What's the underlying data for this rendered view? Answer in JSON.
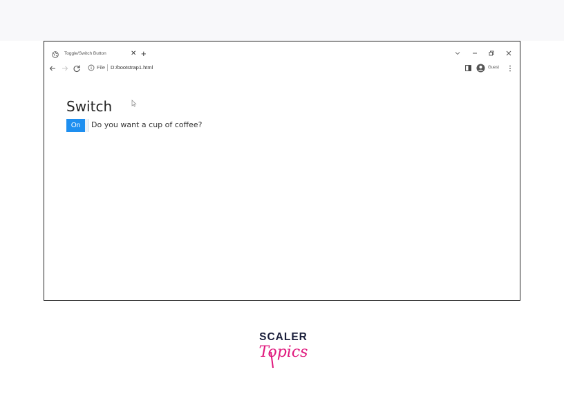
{
  "browser": {
    "tab": {
      "title": "Toggle/Switch Button",
      "favicon_icon": "globe-icon"
    },
    "toolbar": {
      "url_scheme": "File",
      "url_path": "D:/bootstrap1.html",
      "profile_name": "Guest"
    }
  },
  "page": {
    "title": "Switch",
    "switch": {
      "state_label": "On",
      "state": true,
      "question": "Do you want a cup of coffee?"
    }
  },
  "brand": {
    "wordmark_top": "SCALER",
    "wordmark_bottom": "Topics",
    "colors": {
      "navy": "#1b1f3b",
      "pink": "#e0197d"
    }
  },
  "colors": {
    "switch_on": "#1e8ff0"
  }
}
